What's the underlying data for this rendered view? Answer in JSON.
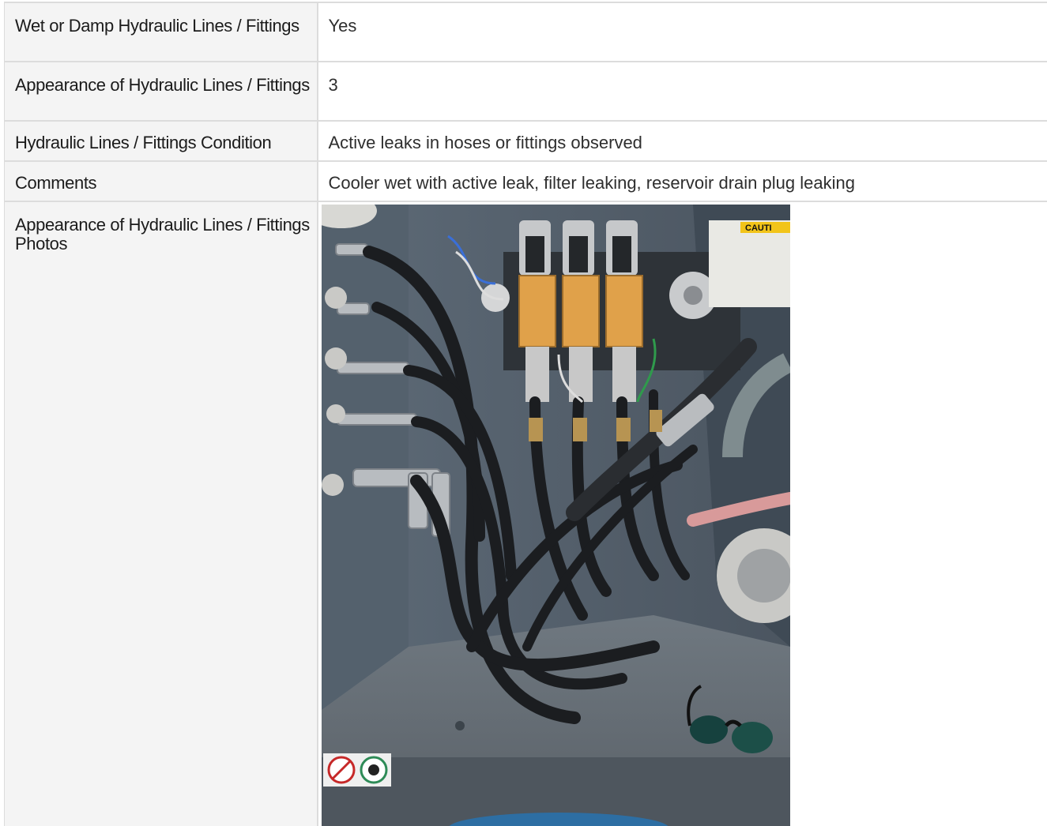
{
  "rows": [
    {
      "label": "Wet or Damp Hydraulic Lines / Fittings",
      "value": "Yes"
    },
    {
      "label": "Appearance of Hydraulic Lines / Fittings",
      "value": "3"
    },
    {
      "label": "Hydraulic Lines / Fittings Condition",
      "value": "Active leaks in hoses or fittings observed"
    },
    {
      "label": "Comments",
      "value": "Cooler wet with active leak, filter leaking, reservoir drain plug leaking"
    },
    {
      "label": "Appearance of Hydraulic Lines / Fittings Photos"
    }
  ],
  "photo": {
    "caution_text": "CAUTI"
  }
}
